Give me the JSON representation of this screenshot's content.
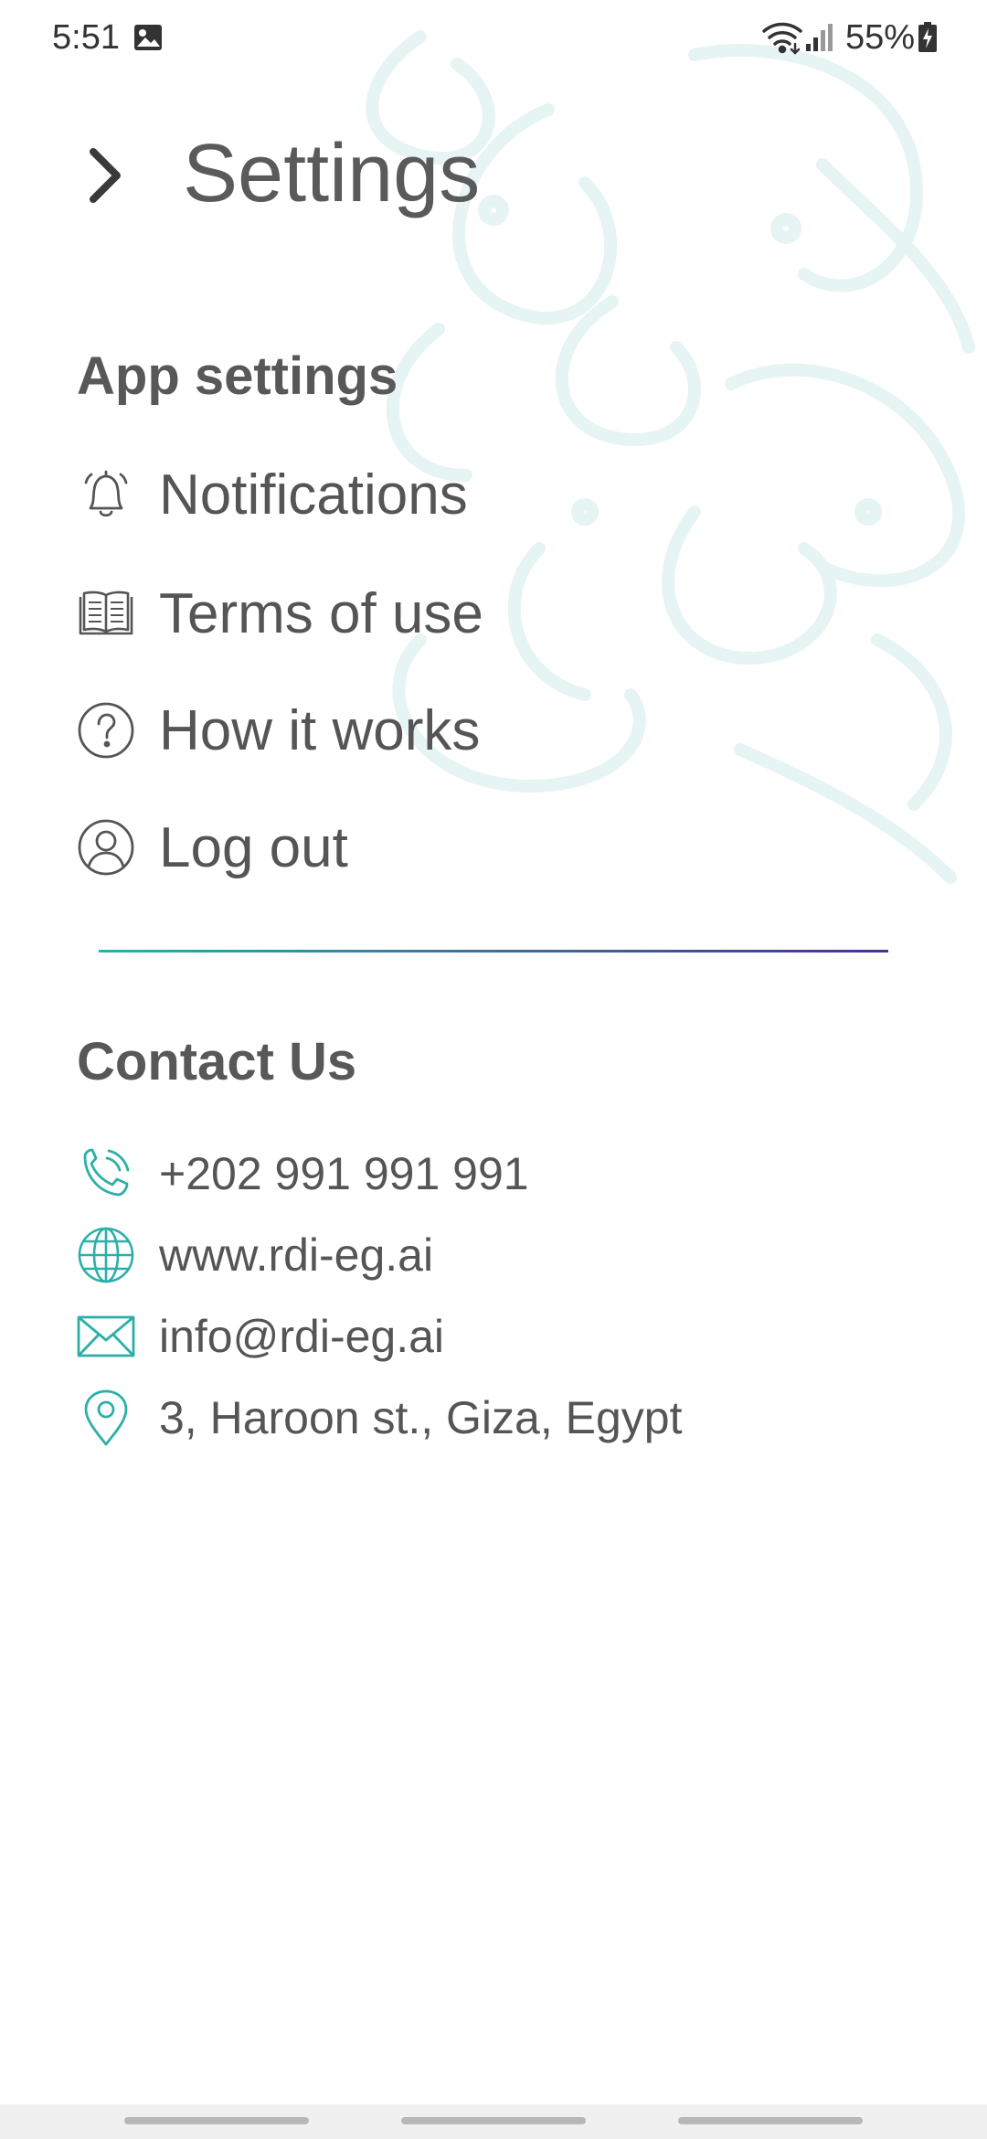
{
  "status_bar": {
    "time": "5:51",
    "battery": "55%",
    "icons": [
      "gallery-icon",
      "wifi-icon",
      "signal-icon",
      "battery-charging-icon"
    ]
  },
  "header": {
    "title": "Settings",
    "back_icon": "chevron-right-icon"
  },
  "app_settings": {
    "title": "App settings",
    "items": [
      {
        "label": "Notifications",
        "icon": "bell-icon"
      },
      {
        "label": "Terms of use",
        "icon": "book-icon"
      },
      {
        "label": "How it works",
        "icon": "question-circle-icon"
      },
      {
        "label": "Log out",
        "icon": "user-circle-icon"
      }
    ]
  },
  "contact": {
    "title": "Contact Us",
    "items": [
      {
        "label": "+202 991 991 991",
        "icon": "phone-icon"
      },
      {
        "label": "www.rdi-eg.ai",
        "icon": "globe-icon"
      },
      {
        "label": "info@rdi-eg.ai",
        "icon": "mail-icon"
      },
      {
        "label": "3, Haroon st., Giza, Egypt",
        "icon": "location-pin-icon"
      }
    ]
  },
  "colors": {
    "accent": "#2bb0a6",
    "accent_end": "#47309a",
    "text": "#5a5a5a",
    "background_art": "#e8f5f4"
  }
}
